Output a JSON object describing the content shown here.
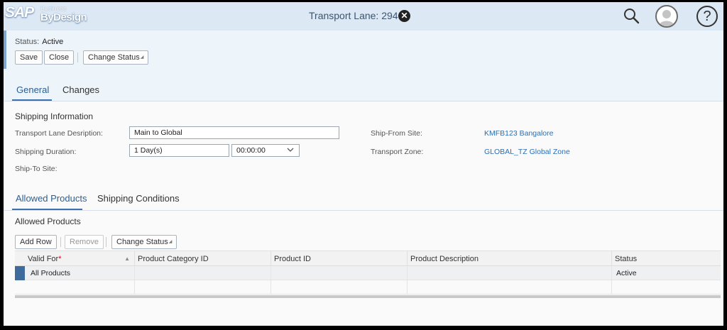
{
  "shell": {
    "logo": {
      "brand": "SAP",
      "line1": "Business",
      "line2": "ByDesign"
    },
    "title": "Transport Lane: 294",
    "close_glyph": "✕",
    "help_glyph": "?"
  },
  "header": {
    "status_label": "Status:",
    "status_value": "Active",
    "buttons": {
      "save": "Save",
      "close": "Close",
      "change_status": "Change Status"
    }
  },
  "tabs": {
    "general": "General",
    "changes": "Changes"
  },
  "shipping": {
    "title": "Shipping Information",
    "transport_lane_description_label": "Transport Lane Desription:",
    "transport_lane_description_value": "Main to Global",
    "shipping_duration_label": "Shipping Duration:",
    "shipping_duration_days": "1 Day(s)",
    "shipping_duration_time": "00:00:00",
    "ship_to_site_label": "Ship-To Site:",
    "ship_from_site_label": "Ship-From Site:",
    "ship_from_site_value": "KMFB123 Bangalore",
    "transport_zone_label": "Transport Zone:",
    "transport_zone_value": "GLOBAL_TZ Global Zone"
  },
  "subtabs": {
    "allowed_products": "Allowed Products",
    "shipping_conditions": "Shipping Conditions"
  },
  "allowed_products": {
    "title": "Allowed Products",
    "buttons": {
      "add_row": "Add Row",
      "remove": "Remove",
      "change_status": "Change Status"
    },
    "columns": [
      "Valid For",
      "Product Category ID",
      "Product ID",
      "Product Description",
      "Status"
    ],
    "required_marker": "*",
    "rows": [
      {
        "valid_for": "All Products",
        "product_category_id": "",
        "product_id": "",
        "product_description": "",
        "status": "Active"
      },
      {
        "valid_for": "",
        "product_category_id": "",
        "product_id": "",
        "product_description": "",
        "status": ""
      }
    ]
  },
  "colors": {
    "shell_bg": "#dce8f3",
    "header_bg": "#edf4fa",
    "link": "#2a6fb5",
    "accent": "#3a72b0",
    "row_marker": "#3f6b9c"
  },
  "icons": {
    "search": "search-icon",
    "user": "user-avatar-icon",
    "help": "help-icon",
    "close": "close-icon",
    "dropdown": "chevron-down-icon",
    "sort": "sort-icon"
  }
}
